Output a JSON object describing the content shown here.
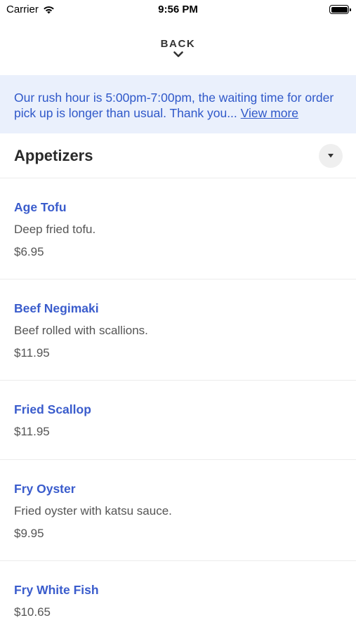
{
  "status_bar": {
    "carrier": "Carrier",
    "time": "9:56 PM"
  },
  "nav": {
    "back_label": "BACK"
  },
  "notice": {
    "text": "Our rush hour is 5:00pm-7:00pm, the waiting time for order pick up is longer than usual. Thank you...",
    "link_label": "View more"
  },
  "section": {
    "title": "Appetizers"
  },
  "items": [
    {
      "name": "Age Tofu",
      "description": "Deep fried tofu.",
      "price": "$6.95"
    },
    {
      "name": "Beef Negimaki",
      "description": "Beef rolled with scallions.",
      "price": "$11.95"
    },
    {
      "name": "Fried Scallop",
      "price": "$11.95"
    },
    {
      "name": "Fry Oyster",
      "description": "Fried oyster with katsu sauce.",
      "price": "$9.95"
    },
    {
      "name": "Fry White Fish",
      "price": "$10.65"
    }
  ],
  "colors": {
    "accent": "#3a5ccc",
    "notice_bg": "#eaf0fc"
  }
}
